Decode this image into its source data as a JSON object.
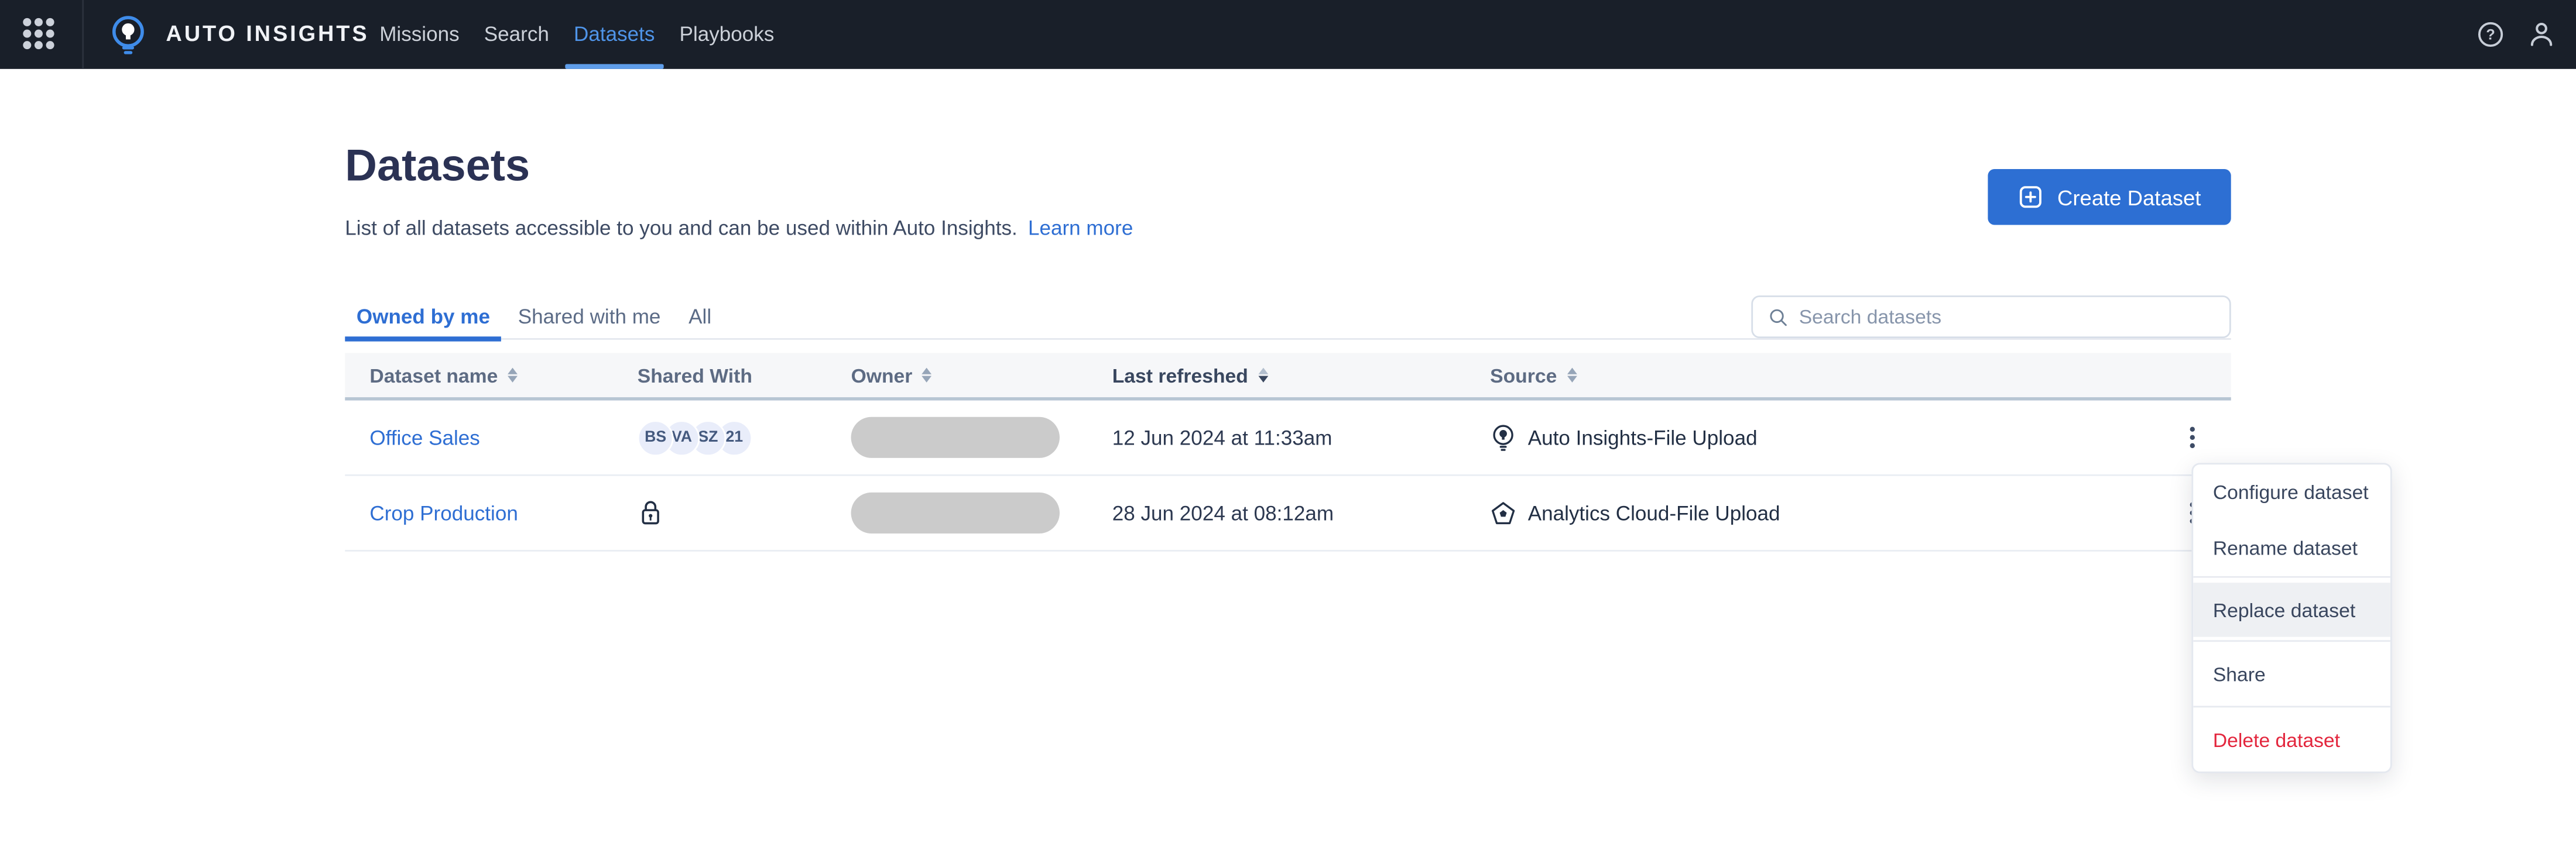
{
  "colors": {
    "navbar_bg": "#191f29",
    "accent_blue": "#2d6fd3",
    "nav_active_blue": "#4f94e8",
    "link_blue": "#2e6ed3",
    "danger_red": "#e3263d",
    "title_navy": "#2b3254",
    "sorted_header": "#39475f",
    "owner_redacted_gray": "#cbcbcb",
    "avatar_bg": "#e9edfa",
    "menu_highlight": "#eef0f3"
  },
  "navbar": {
    "brand": "AUTO INSIGHTS",
    "items": [
      {
        "label": "Missions",
        "active": false
      },
      {
        "label": "Search",
        "active": false
      },
      {
        "label": "Datasets",
        "active": true
      },
      {
        "label": "Playbooks",
        "active": false
      }
    ],
    "right_icons": [
      "help-icon",
      "user-icon"
    ]
  },
  "page": {
    "title": "Datasets",
    "subtitle": "List of all datasets accessible to you and can be used within Auto Insights.",
    "learn_more": "Learn more",
    "create_button": "Create Dataset"
  },
  "tabs": [
    {
      "label": "Owned by me",
      "active": true
    },
    {
      "label": "Shared with me",
      "active": false
    },
    {
      "label": "All",
      "active": false
    }
  ],
  "search": {
    "placeholder": "Search datasets",
    "value": ""
  },
  "table": {
    "columns": [
      {
        "label": "Dataset name",
        "sortable": true
      },
      {
        "label": "Shared With",
        "sortable": false
      },
      {
        "label": "Owner",
        "sortable": true
      },
      {
        "label": "Last refreshed",
        "sortable": true,
        "sorted": "desc"
      },
      {
        "label": "Source",
        "sortable": true
      }
    ],
    "rows": [
      {
        "name": "Office Sales",
        "shared_with": {
          "type": "avatars",
          "avatars": [
            "BS",
            "VA",
            "SZ",
            "21"
          ]
        },
        "owner": {
          "redacted": true
        },
        "last_refreshed": "12 Jun 2024 at 11:33am",
        "source": {
          "icon": "auto-insights-bulb",
          "label": "Auto Insights-File Upload"
        }
      },
      {
        "name": "Crop Production",
        "shared_with": {
          "type": "private-lock"
        },
        "owner": {
          "redacted": true
        },
        "last_refreshed": "28 Jun 2024 at 08:12am",
        "source": {
          "icon": "analytics-cloud-pentagon",
          "label": "Analytics Cloud-File Upload"
        }
      }
    ]
  },
  "context_menu": {
    "items": [
      {
        "label": "Configure dataset",
        "highlighted": false,
        "danger": false
      },
      {
        "label": "Rename dataset",
        "highlighted": false,
        "danger": false
      },
      {
        "label": "Replace dataset",
        "highlighted": true,
        "danger": false
      },
      {
        "label": "Share",
        "highlighted": false,
        "danger": false
      },
      {
        "label": "Delete dataset",
        "highlighted": false,
        "danger": true
      }
    ]
  }
}
